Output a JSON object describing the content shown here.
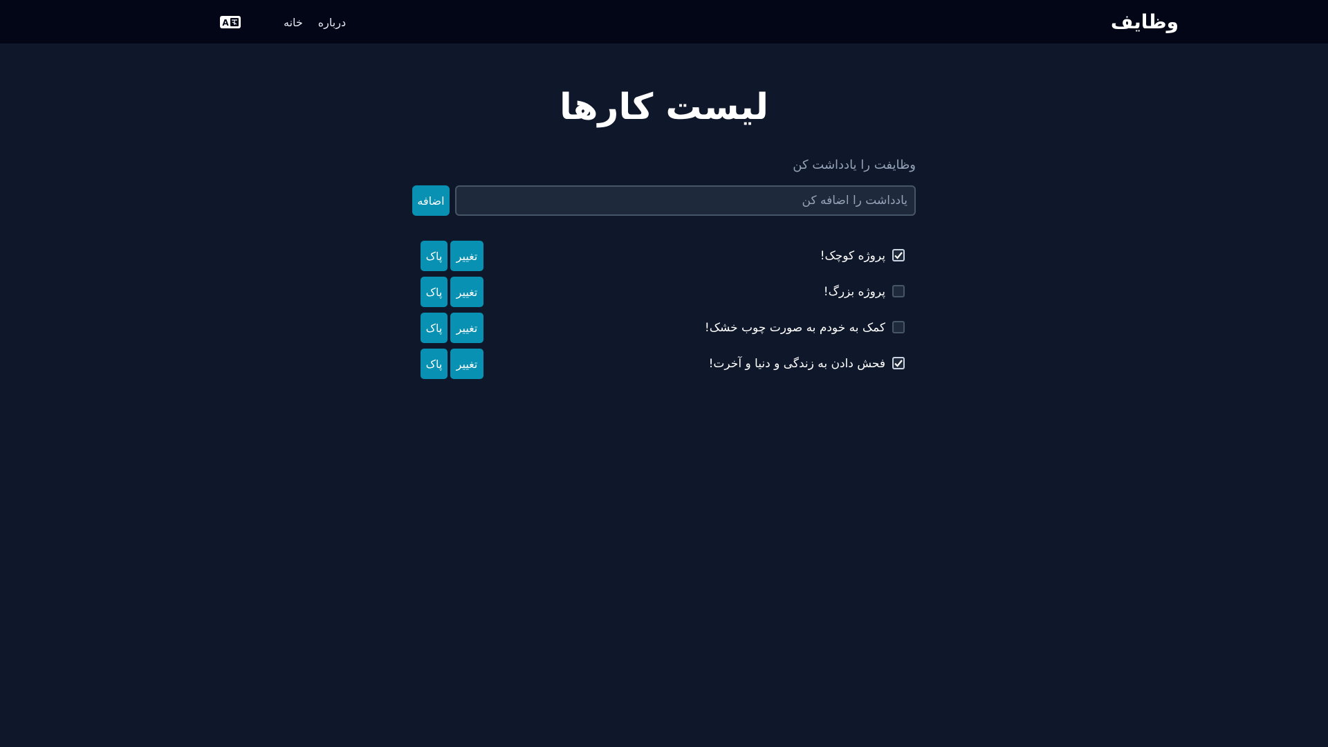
{
  "navbar": {
    "brand": "وظایف",
    "links": [
      {
        "label": "خانه"
      },
      {
        "label": "درباره"
      }
    ],
    "language_icon": "language-icon"
  },
  "main": {
    "title": "لیست کارها",
    "subtitle": "وظایفت را یادداشت کن",
    "input": {
      "placeholder": "یادداشت را اضافه کن",
      "value": ""
    },
    "add_label": "اضافه",
    "edit_label": "تغییر",
    "delete_label": "پاک",
    "todos": [
      {
        "text": "پروژه کوچک!",
        "checked": true
      },
      {
        "text": "پروژه بزرگ!",
        "checked": false
      },
      {
        "text": "کمک به خودم به صورت چوب خشک!",
        "checked": false
      },
      {
        "text": "فحش دادن به زندگی و دنیا و آخرت!",
        "checked": true
      }
    ]
  },
  "colors": {
    "background": "#0f172a",
    "navbar": "#020617",
    "accent": "#0891b2",
    "input_bg": "#1e293b",
    "muted_text": "#94a3b8"
  }
}
